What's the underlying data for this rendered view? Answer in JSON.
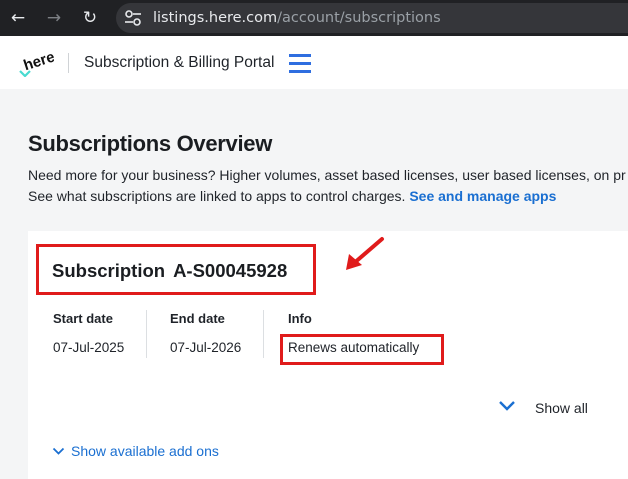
{
  "browser": {
    "url_host": "listings.here.com",
    "url_path": "/account/subscriptions"
  },
  "header": {
    "logo_text": "here",
    "portal_title": "Subscription & Billing Portal"
  },
  "main": {
    "page_title": "Subscriptions Overview",
    "description_line1": "Need more for your business? Higher volumes, asset based licenses, user based licenses, on pr",
    "description_line2": "See what subscriptions are linked to apps to control charges. ",
    "manage_apps_link": "See and manage apps"
  },
  "subscription": {
    "label": "Subscription",
    "id": "A-S00045928",
    "columns": [
      {
        "label": "Start date",
        "value": "07-Jul-2025"
      },
      {
        "label": "End date",
        "value": "07-Jul-2026"
      },
      {
        "label": "Info",
        "value": "Renews automatically"
      }
    ],
    "show_all_label": "Show all",
    "addons_label": "Show available add ons"
  },
  "colors": {
    "accent": "#1a6fd1",
    "highlight": "#e01b1b",
    "logo_green": "#48dad0"
  }
}
